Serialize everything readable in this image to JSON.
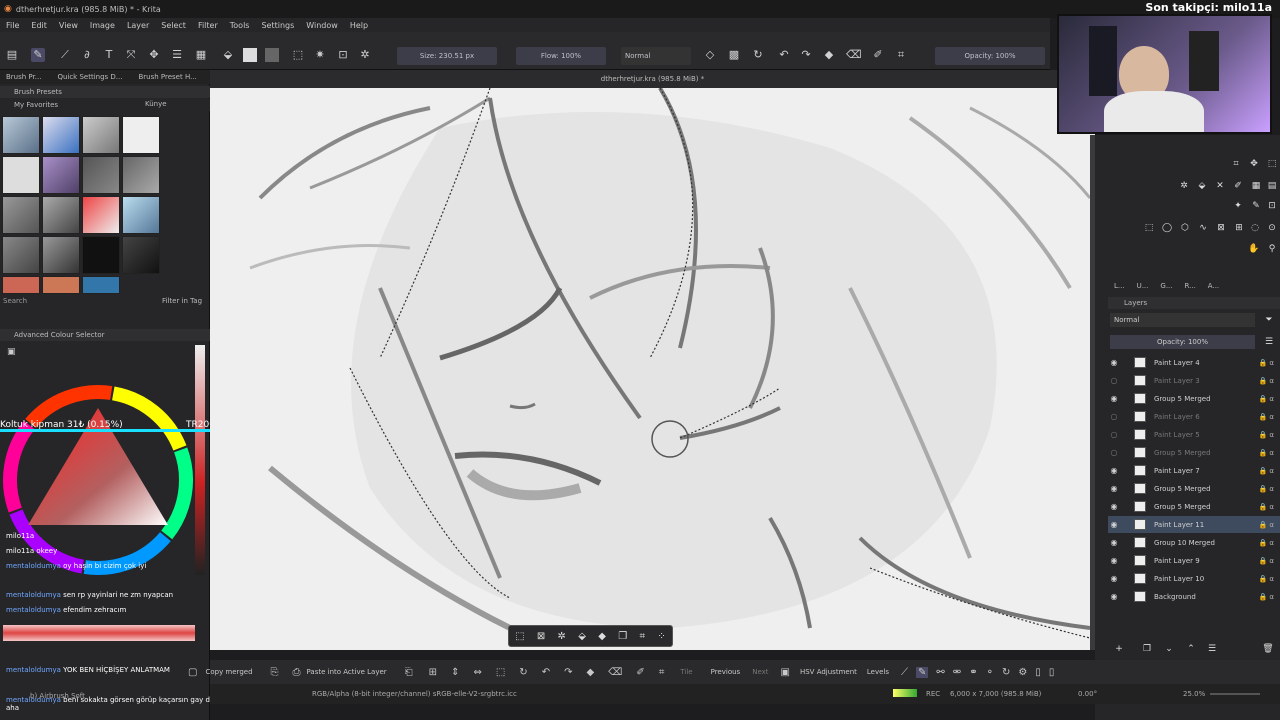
{
  "window": {
    "title": "dtherhretjur.kra (985.8 MiB) * - Krita"
  },
  "stream": {
    "follower_text": "Son takipçi: milo11a"
  },
  "menu": [
    "File",
    "Edit",
    "View",
    "Image",
    "Layer",
    "Select",
    "Filter",
    "Tools",
    "Settings",
    "Window",
    "Help"
  ],
  "toolbar": {
    "size_field": "Size: 230.51 px",
    "flow_field": "Flow: 100%",
    "blend_mode": "Normal",
    "opacity_field": "Opacity: 100%"
  },
  "tabs": [
    "Brush Pr...",
    "Quick Settings D...",
    "Brush Preset H..."
  ],
  "document": {
    "title": "dtherhretjur.kra (985.8 MiB) *"
  },
  "brush_presets": {
    "header": "Brush Presets",
    "tag": "My Favorites",
    "tag_side": "Künye",
    "search_placeholder": "Search",
    "filter_label": "Filter in Tag"
  },
  "colour_selector": {
    "header": "Advanced Colour Selector"
  },
  "overlay": {
    "left_text": "Koltuk kipman   31₺ (0.15%)",
    "right_text": "TR20000",
    "accent": "#19e0ff"
  },
  "chat": [
    {
      "user": "milo11a",
      "text": ""
    },
    {
      "user": "",
      "text": "milo11a okeey"
    },
    {
      "user": "mentaloldumya",
      "text": "oy haşin bi cizim çok iyi"
    },
    {
      "user": "mentaloldumya",
      "text": "sen rp yayinlari ne zm nyapcan"
    },
    {
      "user": "mentaloldumya",
      "text": "efendim zehracım"
    },
    {
      "user": "mentaloldumya",
      "text": "YOK BEN HİÇBİŞEY ANLATMAM"
    },
    {
      "user": "mentaloldumya",
      "text": "beni sokakta görsen görüp kaçarsın gay deme bana bi aha"
    }
  ],
  "layers": {
    "header": "Layers",
    "blend_mode": "Normal",
    "opacity": "Opacity: 100%",
    "tabs": [
      "L...",
      "U...",
      "G...",
      "R...",
      "A..."
    ],
    "items": [
      {
        "name": "Paint Layer 4",
        "visible": true
      },
      {
        "name": "Paint Layer 3",
        "visible": false
      },
      {
        "name": "Group 5 Merged",
        "visible": true
      },
      {
        "name": "Paint Layer 6",
        "visible": false
      },
      {
        "name": "Paint Layer 5",
        "visible": false
      },
      {
        "name": "Group 5 Merged",
        "visible": false
      },
      {
        "name": "Paint Layer 7",
        "visible": true
      },
      {
        "name": "Group 5 Merged",
        "visible": true
      },
      {
        "name": "Group 5 Merged",
        "visible": true
      },
      {
        "name": "Paint Layer 11",
        "visible": true
      },
      {
        "name": "Group 10 Merged",
        "visible": true
      },
      {
        "name": "Paint Layer 9",
        "visible": true
      },
      {
        "name": "Paint Layer 10",
        "visible": true
      },
      {
        "name": "Background",
        "visible": true
      }
    ]
  },
  "bottom_toolbar": {
    "copy_merged": "Copy merged",
    "paste_active": "Paste into Active Layer",
    "tile": "Tile",
    "previous": "Previous",
    "next": "Next",
    "hsv": "HSV Adjustment",
    "levels": "Levels"
  },
  "status": {
    "colorspace": "RGB/Alpha (8-bit integer/channel)  sRGB-elle-V2-srgbtrc.icc",
    "rec": "REC",
    "dims": "6,000 x 7,000 (985.8 MiB)",
    "rotation": "0.00°",
    "zoom": "25.0%",
    "brush_name": "b) Airbrush Soft"
  }
}
